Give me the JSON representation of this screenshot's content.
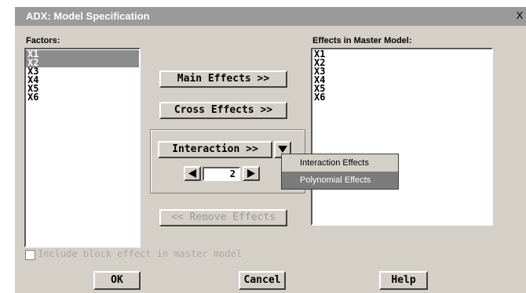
{
  "window": {
    "title": "ADX: Model Specification",
    "close_glyph": "X"
  },
  "factors": {
    "label": "Factors:",
    "items": [
      "X1",
      "X2",
      "X3",
      "X4",
      "X5",
      "X6"
    ],
    "selected": [
      "X1",
      "X2"
    ]
  },
  "effects": {
    "label": "Effects in Master Model:",
    "items": [
      "X1",
      "X2",
      "X3",
      "X4",
      "X5",
      "X6"
    ]
  },
  "buttons": {
    "main_effects": "Main Effects >>",
    "cross_effects": "Cross Effects >>",
    "interaction": "Interaction >>",
    "remove_effects": "<< Remove Effects",
    "ok": "OK",
    "cancel": "Cancel",
    "help": "Help"
  },
  "interaction_order": {
    "value": "2"
  },
  "dropdown": {
    "options": [
      "Interaction Effects",
      "Polynomial Effects"
    ],
    "highlighted": "Polynomial Effects"
  },
  "checkbox": {
    "label": "Include block effect in master model",
    "checked": false,
    "enabled": false
  },
  "icons": {
    "dropdown_arrow": "down-triangle-icon",
    "decrement": "left-triangle-icon",
    "increment": "right-triangle-icon"
  }
}
